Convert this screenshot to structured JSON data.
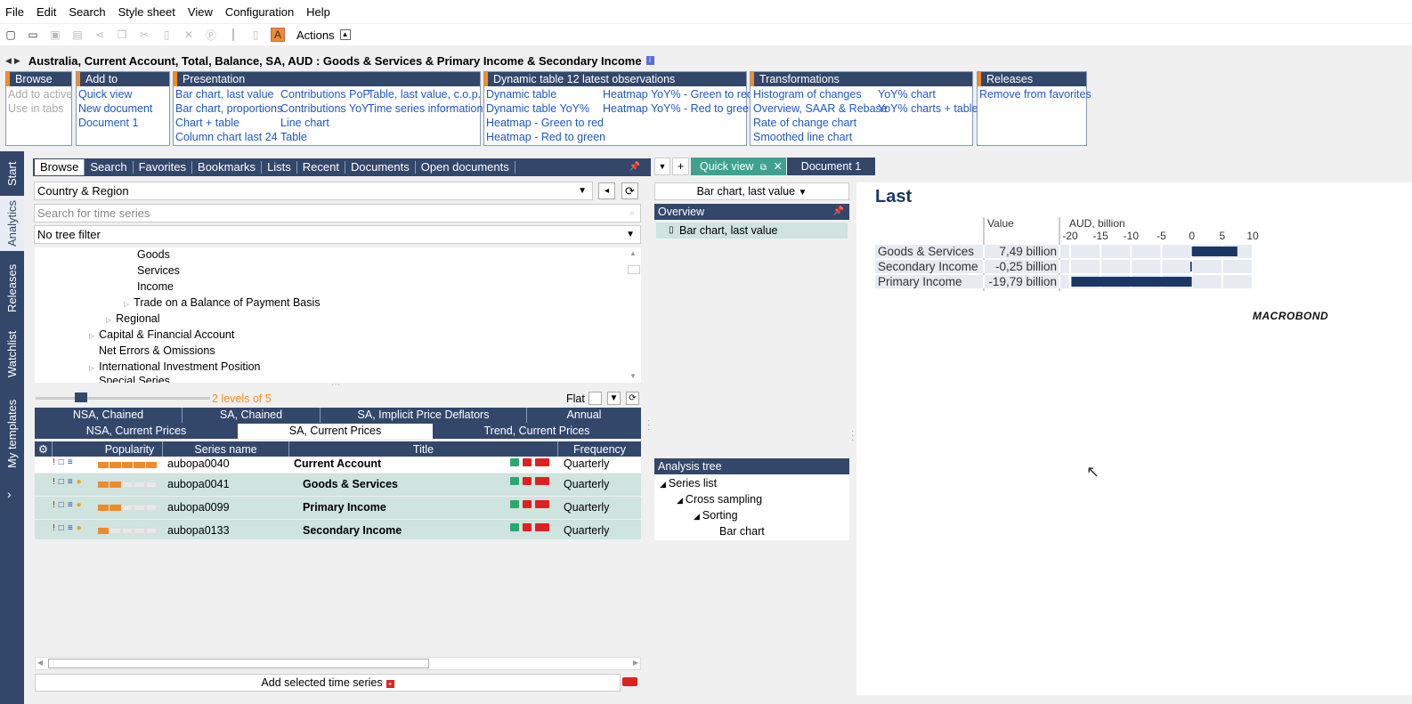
{
  "menu": [
    "File",
    "Edit",
    "Search",
    "Style sheet",
    "View",
    "Configuration",
    "Help"
  ],
  "toolbar": {
    "actions_label": "Actions"
  },
  "title": "Australia, Current Account, Total, Balance, SA, AUD : Goods & Services & Primary Income & Secondary Income",
  "ribbon": {
    "browse": {
      "title": "Browse",
      "items": [
        "Add to active",
        "Use in tabs"
      ]
    },
    "add_to_document": {
      "title": "Add to document",
      "items": [
        "Quick view",
        "New document",
        "Document 1"
      ]
    },
    "presentation": {
      "title": "Presentation",
      "col1": [
        "Bar chart, last value",
        "Bar chart, proportions",
        "Chart + table",
        "Column chart last 24"
      ],
      "col2": [
        "Contributions PoP",
        "Contributions YoY",
        "Line chart",
        "Table"
      ],
      "col3": [
        "Table, last value, c.o.p.",
        "Time series information"
      ]
    },
    "dynamic": {
      "title": "Dynamic table 12 latest observations",
      "col1": [
        "Dynamic table",
        "Dynamic table YoY%",
        "Heatmap - Green to red",
        "Heatmap - Red to green"
      ],
      "col2": [
        "Heatmap YoY% - Green to red",
        "Heatmap YoY% - Red to green"
      ]
    },
    "transformations": {
      "title": "Transformations",
      "col1": [
        "Histogram of changes",
        "Overview, SAAR & Rebase",
        "Rate of change chart",
        "Smoothed line chart"
      ],
      "col2": [
        "YoY% chart",
        "YoY% charts + table"
      ]
    },
    "releases": {
      "title": "Releases",
      "items": [
        "Remove from favorites"
      ]
    }
  },
  "sidebar": [
    "Start",
    "Analytics",
    "Releases",
    "Watchlist",
    "My templates"
  ],
  "browse_tabs": [
    "Browse",
    "Search",
    "Favorites",
    "Bookmarks",
    "Lists",
    "Recent",
    "Documents",
    "Open documents"
  ],
  "country_select": "Country & Region",
  "search_placeholder": "Search for time series",
  "tree_filter": "No tree filter",
  "tree": [
    "Goods",
    "Services",
    "Income",
    "Trade on a Balance of Payment Basis",
    "Regional",
    "Capital & Financial Account",
    "Net Errors & Omissions",
    "International Investment Position",
    "Special Series"
  ],
  "levels": "2 levels of 5",
  "flat": "Flat",
  "filter_tabs_row1": [
    "NSA, Chained",
    "SA, Chained",
    "SA, Implicit Price Deflators",
    "Annual"
  ],
  "filter_tabs_row2": [
    "NSA, Current Prices",
    "SA, Current Prices",
    "Trend, Current Prices"
  ],
  "grid_headers": [
    "Popularity",
    "Series name",
    "Title",
    "Frequency"
  ],
  "rows": [
    {
      "name": "aubopa0040",
      "title": "Current Account",
      "freq": "Quarterly",
      "pop": 5
    },
    {
      "name": "aubopa0041",
      "title": "Goods & Services",
      "freq": "Quarterly",
      "pop": 2
    },
    {
      "name": "aubopa0099",
      "title": "Primary Income",
      "freq": "Quarterly",
      "pop": 2
    },
    {
      "name": "aubopa0133",
      "title": "Secondary Income",
      "freq": "Quarterly",
      "pop": 1
    }
  ],
  "add_selected": "Add selected time series",
  "doc_tabs": {
    "quick_view": "Quick view",
    "document1": "Document 1"
  },
  "bar_select": "Bar chart, last value",
  "overview": {
    "title": "Overview",
    "item": "Bar chart, last value"
  },
  "analysis_tree": {
    "title": "Analysis tree",
    "items": [
      "Series list",
      "Cross sampling",
      "Sorting",
      "Bar chart"
    ]
  },
  "chart_data": {
    "type": "bar",
    "title": "Last",
    "value_header": "Value",
    "unit": "AUD, billion",
    "categories": [
      "Goods & Services",
      "Secondary Income",
      "Primary Income"
    ],
    "values": [
      7.49,
      -0.25,
      -19.79
    ],
    "value_labels": [
      "7,49 billion",
      "-0,25 billion",
      "-19,79 billion"
    ],
    "xlim": [
      -20,
      10
    ],
    "ticks": [
      "-20",
      "-15",
      "-10",
      "-5",
      "0",
      "5",
      "10"
    ],
    "logo": "MACROBOND",
    "bar_color": "#1b3766"
  }
}
